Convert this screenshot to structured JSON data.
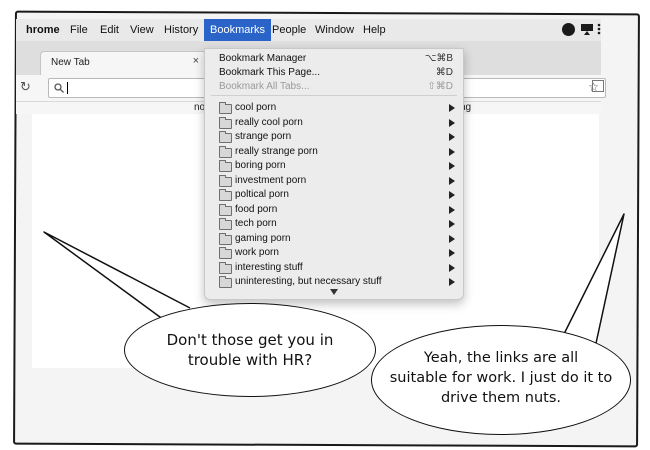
{
  "menubar": {
    "app_name": "hrome",
    "items": [
      {
        "label": "File"
      },
      {
        "label": "Edit"
      },
      {
        "label": "View"
      },
      {
        "label": "History"
      },
      {
        "label": "Bookmarks",
        "active": true
      },
      {
        "label": "People"
      },
      {
        "label": "Window"
      },
      {
        "label": "Help"
      }
    ],
    "status_icons": [
      "record-icon",
      "airplay-icon"
    ]
  },
  "tab": {
    "title": "New Tab",
    "close_glyph": "×"
  },
  "toolbar": {
    "reload_glyph": "↻",
    "search_glyph": "🔍",
    "star_glyph": "☆"
  },
  "bookmarks_bar": {
    "left_fragment": "no",
    "right_fragment": "ng"
  },
  "bookmarks_menu": {
    "commands": [
      {
        "label": "Bookmark Manager",
        "shortcut": "⌥⌘B",
        "enabled": true
      },
      {
        "label": "Bookmark This Page...",
        "shortcut": "⌘D",
        "enabled": true
      },
      {
        "label": "Bookmark All Tabs...",
        "shortcut": "⇧⌘D",
        "enabled": false
      }
    ],
    "folders": [
      "cool porn",
      "really cool porn",
      "strange porn",
      "really strange porn",
      "boring porn",
      "investment porn",
      "poltical porn",
      "food porn",
      "tech porn",
      "gaming porn",
      "work porn",
      "interesting stuff",
      "uninteresting, but necessary stuff"
    ]
  },
  "bubbles": {
    "left": [
      "Don't those get you in",
      "trouble with HR?"
    ],
    "right": [
      "Yeah, the links are all",
      "suitable for work. I just do it to",
      "drive them nuts."
    ]
  },
  "colors": {
    "menu_highlight": "#2a64c8",
    "panel_background": "#f4f4f4"
  }
}
